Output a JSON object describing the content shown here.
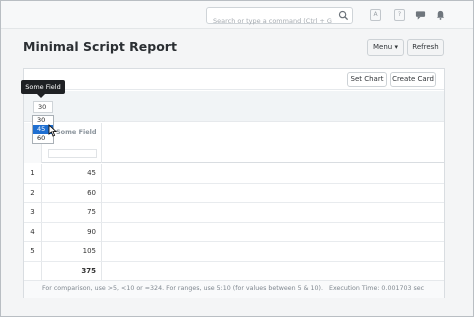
{
  "search": {
    "placeholder": "Search or type a command (Ctrl + G)"
  },
  "navbar": {
    "icons": [
      "search-icon",
      "app-icon",
      "help-icon",
      "chat-icon",
      "bell-icon"
    ]
  },
  "page": {
    "title": "Minimal Script Report"
  },
  "actions": {
    "menu_label": "Menu ▾",
    "refresh_label": "Refresh"
  },
  "card": {
    "set_chart_label": "Set Chart",
    "create_card_label": "Create Card"
  },
  "filter": {
    "selected_value": "30",
    "tooltip": "Some Field"
  },
  "dropdown": {
    "options": [
      "30",
      "45",
      "60"
    ],
    "highlighted_index": 1
  },
  "table": {
    "column_header": "Some Field",
    "rows": [
      {
        "index": "1",
        "value": "45"
      },
      {
        "index": "2",
        "value": "60"
      },
      {
        "index": "3",
        "value": "75"
      },
      {
        "index": "4",
        "value": "90"
      },
      {
        "index": "5",
        "value": "105"
      }
    ],
    "total": "375"
  },
  "footer": {
    "hint": "For comparison, use >5, <10 or =324. For ranges, use 5:10 (for values between 5 & 10).",
    "execution_time": "Execution Time: 0.001703 sec"
  }
}
